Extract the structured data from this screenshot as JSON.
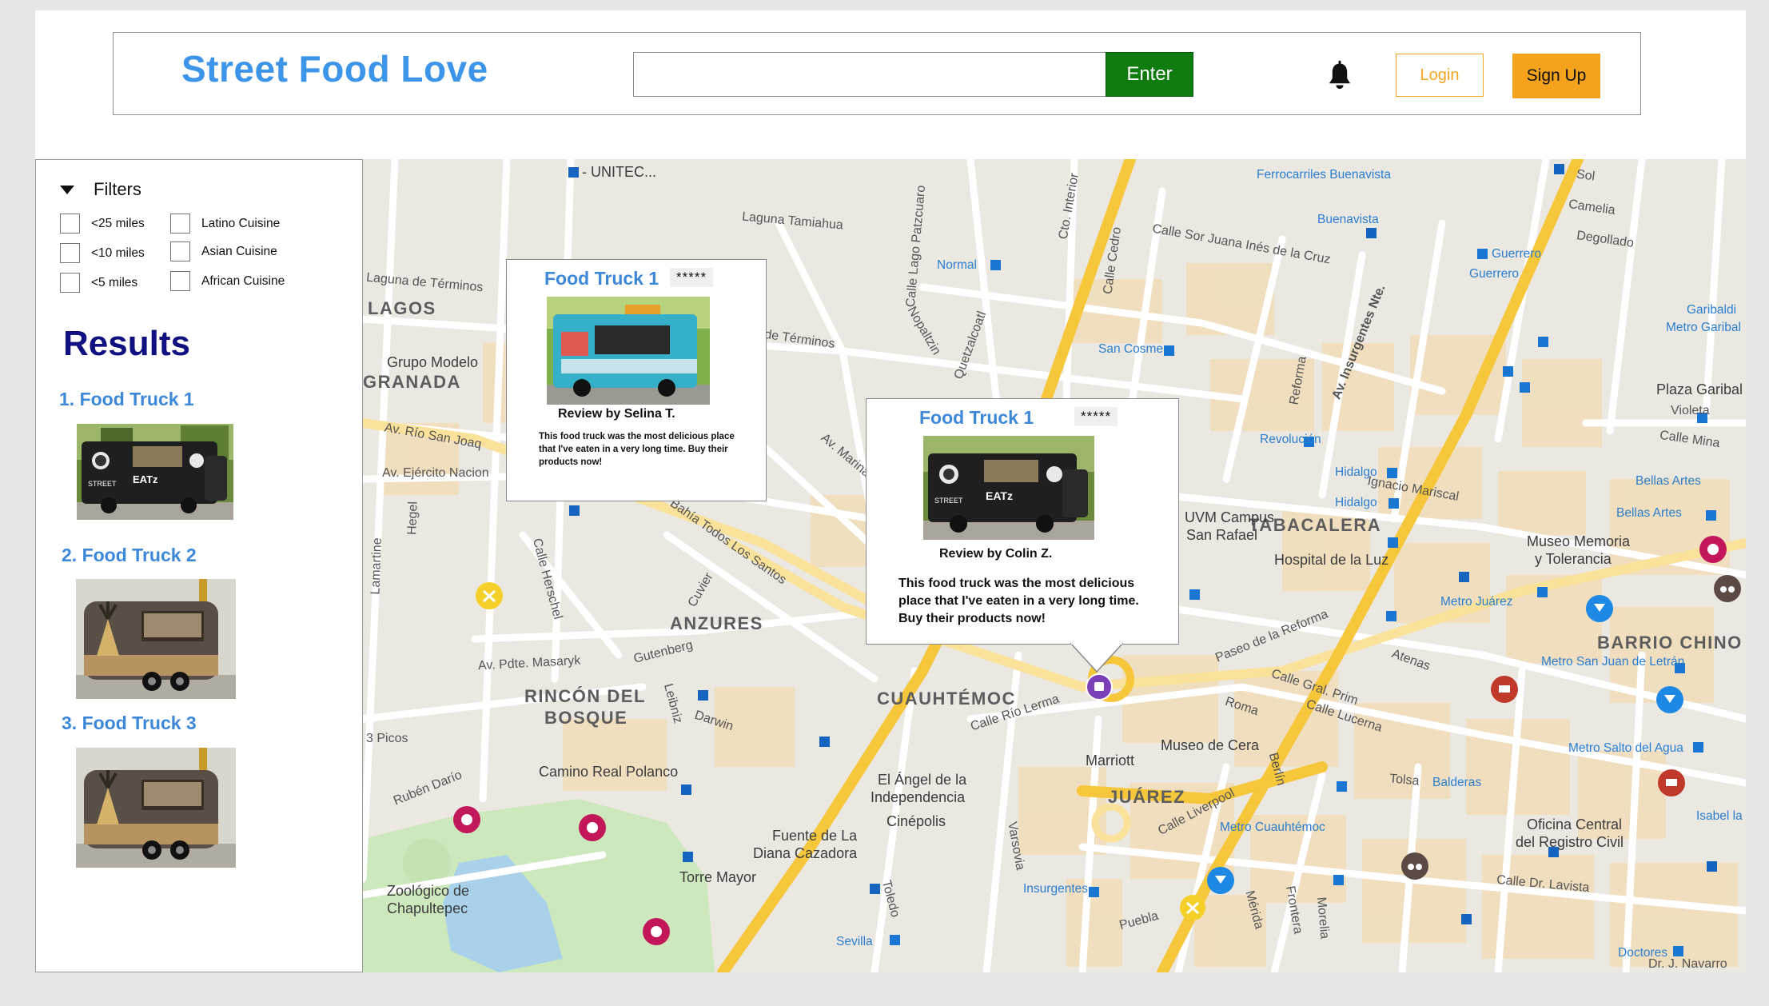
{
  "header": {
    "title": "Street Food Love",
    "search": {
      "value": "",
      "placeholder": ""
    },
    "enter_label": "Enter",
    "login_label": "Login",
    "signup_label": "Sign Up"
  },
  "filters": {
    "label": "Filters",
    "distance": [
      "<25 miles",
      "<10 miles",
      "<5 miles"
    ],
    "cuisine": [
      "Latino Cuisine",
      "Asian Cuisine",
      "African Cuisine"
    ]
  },
  "results": {
    "heading": "Results",
    "items": [
      {
        "label": "1. Food Truck 1"
      },
      {
        "label": "2. Food Truck 2"
      },
      {
        "label": "3. Food Truck 3"
      }
    ]
  },
  "popups": [
    {
      "title": "Food Truck 1",
      "stars": "*****",
      "reviewer": "Review by Selina T.",
      "text": "This food truck was the most delicious place that I've eaten in a very long time. Buy their products now!"
    },
    {
      "title": "Food Truck 1",
      "stars": "*****",
      "reviewer": "Review by Colin Z.",
      "text": "This food truck was the most delicious place that I've eaten in a very long time. Buy their products now!"
    }
  ],
  "map": {
    "areas": [
      "LAGOS",
      "GRANADA",
      "ANZURES",
      "RINCÓN DEL",
      "BOSQUE",
      "CUAUHTÉMOC",
      "JUÁREZ",
      "TABACALERA",
      "BARRIO CHINO"
    ],
    "places": [
      "Grupo Modelo",
      "Camino Real Polanco",
      "Zoológico de",
      "Chapultepec",
      "El Ángel de la",
      "Independencia",
      "Cinépolis",
      "Fuente de La",
      "Diana Cazadora",
      "Torre Mayor",
      "Marriott",
      "Museo de Cera",
      "UVM Campus",
      "San Rafael",
      "Hospital de la Luz",
      "Museo Memoria",
      "y Tolerancia",
      "Oficina Central",
      "del Registro Civil",
      "Plaza Garibal",
      "- UNITEC..."
    ],
    "metro": [
      "Normal",
      "San Cosme",
      "Revolución",
      "Hidalgo",
      "Hidalgo",
      "Buenavista",
      "Guerrero",
      "Guerrero",
      "Bellas Artes",
      "Bellas Artes",
      "Metro Juárez",
      "Metro San Juan de Letrán",
      "Metro Salto del Agua",
      "Metro Cuauhtémoc",
      "Balderas",
      "Insurgentes",
      "Sevilla",
      "Doctores",
      "Isabel la",
      "Garibaldi",
      "Metro Garibal",
      "Ferrocarriles Buenavista"
    ],
    "streets": [
      "Laguna Tamiahua",
      "Laguna de Términos",
      "de Términos",
      "Av. Río San Joaq",
      "Av. Ejército Nacion",
      "Av. Pdte. Masaryk",
      "Gutenberg",
      "Calle Sor Juana Inés de la Cruz",
      "Av. Insurgentes Nte.",
      "Paseo de la Reforma",
      "Calle Río Lerma",
      "Calle Liverpool",
      "Calle Lucerna",
      "Calle Gral. Prim",
      "Ignacio Mariscal",
      "Atenas",
      "Roma",
      "Tolsa",
      "Puebla",
      "Calle Dr. Lavista",
      "Rubén Darío",
      "Darwin",
      "Leibniz",
      "Calle Herschel",
      "Cuvier",
      "Bahía Todos Los Santos",
      "Av. Marina",
      "Nopaltzin",
      "Quetzalcoatl",
      "Sol",
      "Camelia",
      "Degollado",
      "Violeta",
      "Calle Mina",
      "Dr. J. Navarro",
      "Cto. Interior",
      "Calle Cedro",
      "Calle Lago Patzcuaro",
      "Varsovia",
      "Toledo",
      "Mérida",
      "Frontera",
      "Morelia",
      "Berlín",
      "Hegel",
      "Lamartine",
      "Reforma",
      "3 Picos"
    ]
  },
  "colors": {
    "brand": "#3d95ea",
    "enter": "#107c10",
    "signup": "#f5a21d",
    "login_border": "#f5a623",
    "results_heading": "#101080",
    "result_link": "#3d88d9"
  }
}
